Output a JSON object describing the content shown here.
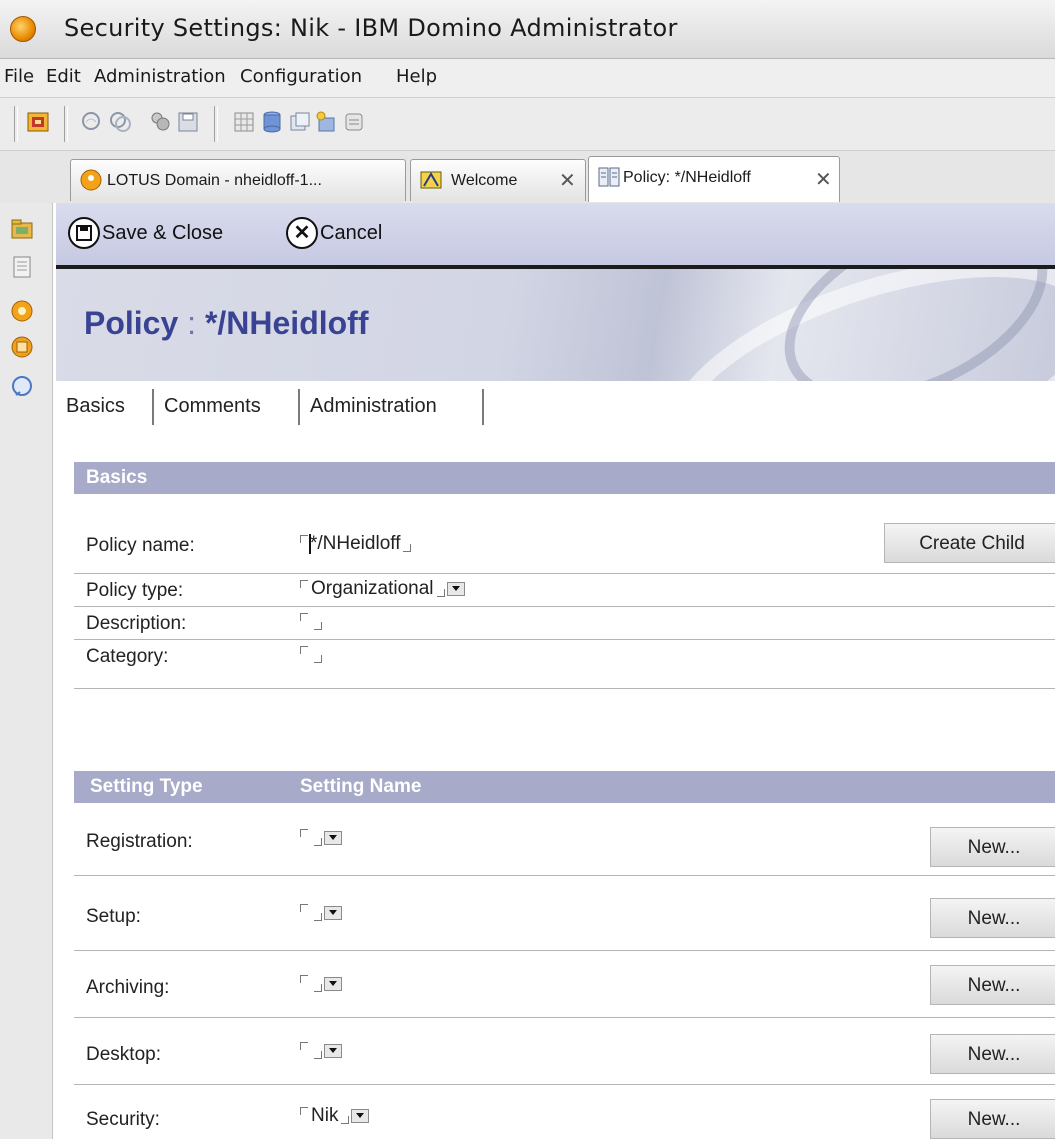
{
  "window": {
    "title": "Security Settings: Nik - IBM Domino Administrator"
  },
  "menu": [
    "File",
    "Edit",
    "Administration",
    "Configuration",
    "Help"
  ],
  "toolbar": {
    "icons": [
      "key-icon",
      "search-icon",
      "search-all-icon",
      "people-icon",
      "save-icon",
      "grid-icon",
      "database-icon",
      "copy-icon",
      "new-db-icon",
      "replica-icon"
    ]
  },
  "tabs": [
    {
      "label": "LOTUS Domain - nheidloff-1...",
      "icon": "domino-server-icon",
      "active": false
    },
    {
      "label": "Welcome",
      "icon": "welcome-icon",
      "active": false
    },
    {
      "label": "Policy: */NHeidloff",
      "icon": "policy-doc-icon",
      "active": true
    }
  ],
  "actions": {
    "save_close": "Save & Close",
    "cancel": "Cancel"
  },
  "page": {
    "title": "Policy",
    "separator": ":",
    "name": "*/NHeidloff"
  },
  "form_tabs": [
    "Basics",
    "Comments",
    "Administration"
  ],
  "basics": {
    "heading": "Basics",
    "policy_name_label": "Policy name:",
    "policy_name_value": "*/NHeidloff",
    "create_child": "Create Child",
    "policy_type_label": "Policy type:",
    "policy_type_value": "Organizational",
    "description_label": "Description:",
    "description_value": "",
    "category_label": "Category:",
    "category_value": ""
  },
  "settings": {
    "col_type": "Setting Type",
    "col_name": "Setting Name",
    "new_label": "New...",
    "rows": [
      {
        "label": "Registration:",
        "value": ""
      },
      {
        "label": "Setup:",
        "value": ""
      },
      {
        "label": "Archiving:",
        "value": ""
      },
      {
        "label": "Desktop:",
        "value": ""
      },
      {
        "label": "Security:",
        "value": "Nik"
      }
    ]
  }
}
